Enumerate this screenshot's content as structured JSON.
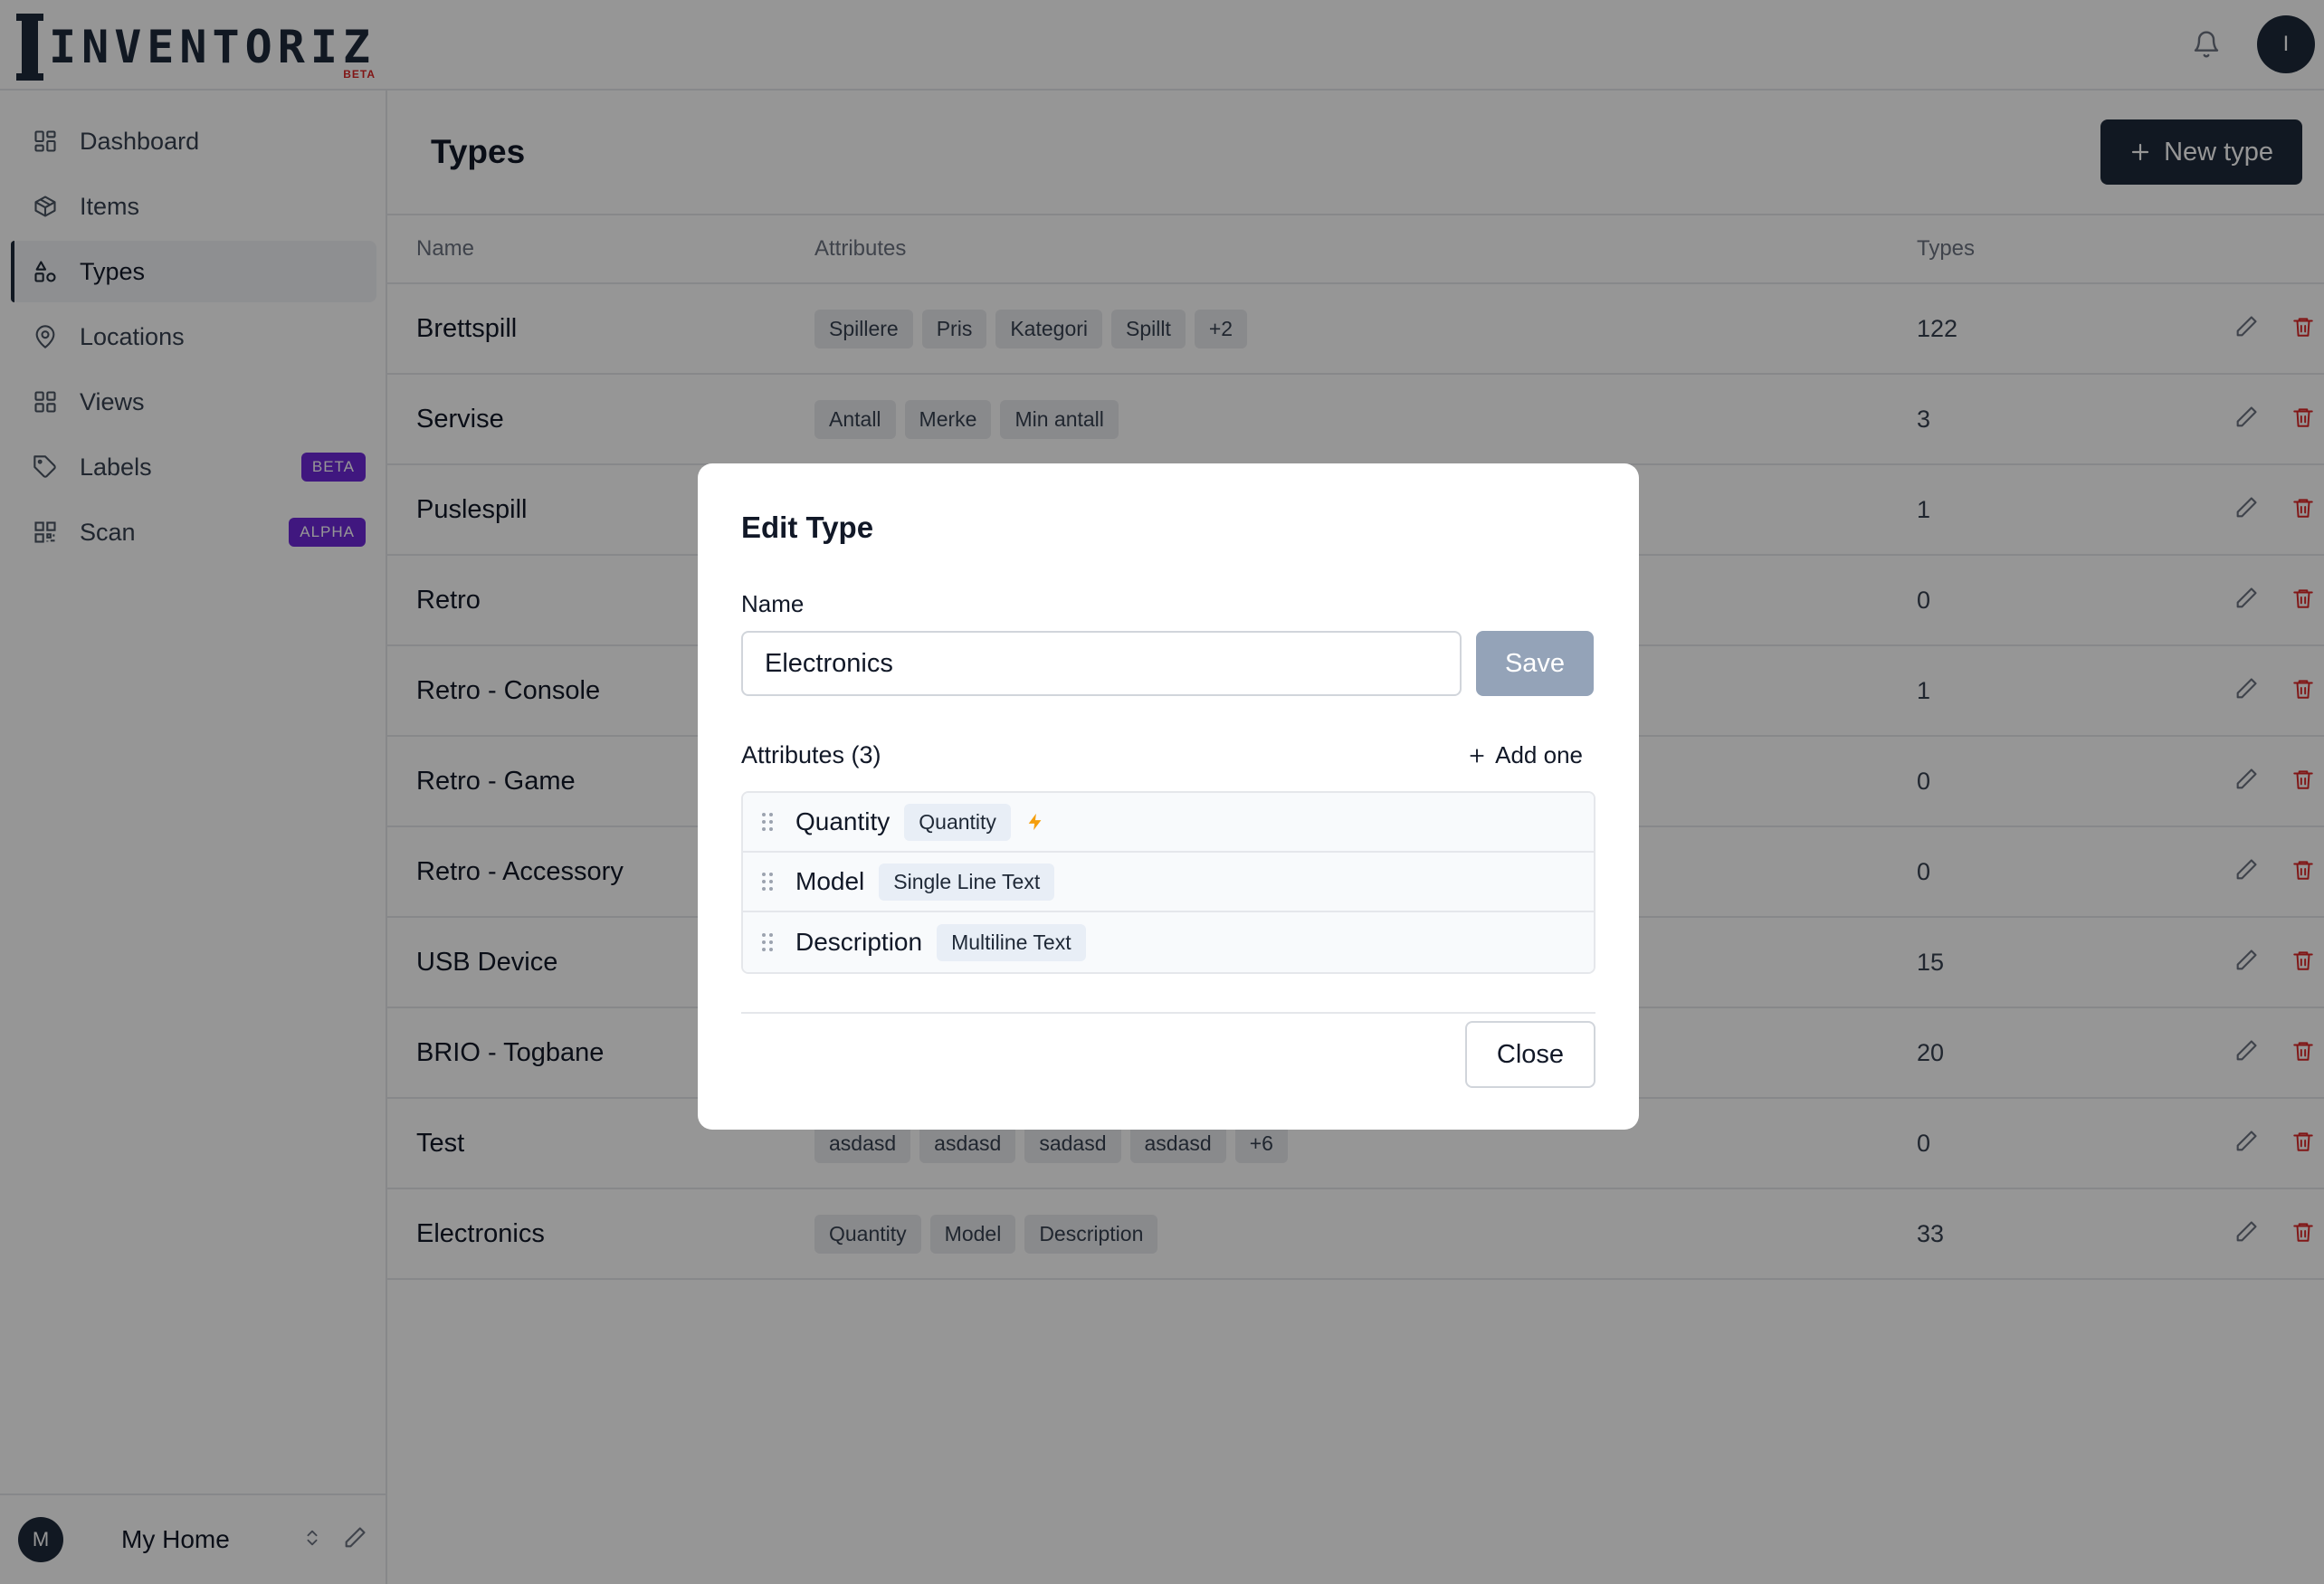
{
  "app": {
    "logo_text": "INVENTORIZ",
    "logo_badge": "BETA",
    "user_initial": "I"
  },
  "sidebar": {
    "items": [
      {
        "label": "Dashboard",
        "icon": "dashboard-icon"
      },
      {
        "label": "Items",
        "icon": "box-icon"
      },
      {
        "label": "Types",
        "icon": "shapes-icon",
        "active": true
      },
      {
        "label": "Locations",
        "icon": "map-pin-icon"
      },
      {
        "label": "Views",
        "icon": "grid-icon"
      },
      {
        "label": "Labels",
        "icon": "tag-icon",
        "badge": "BETA"
      },
      {
        "label": "Scan",
        "icon": "qr-icon",
        "badge": "ALPHA"
      }
    ],
    "footer": {
      "avatar": "M",
      "home_name": "My Home"
    }
  },
  "page": {
    "title": "Types",
    "new_button": "New type"
  },
  "table": {
    "headers": {
      "name": "Name",
      "attributes": "Attributes",
      "types": "Types"
    },
    "rows": [
      {
        "name": "Brettspill",
        "attrs": [
          "Spillere",
          "Pris",
          "Kategori",
          "Spillt",
          "+2"
        ],
        "count": "122"
      },
      {
        "name": "Servise",
        "attrs": [
          "Antall",
          "Merke",
          "Min antall"
        ],
        "count": "3"
      },
      {
        "name": "Puslespill",
        "attrs": [],
        "count": "1"
      },
      {
        "name": "Retro",
        "attrs": [],
        "count": "0"
      },
      {
        "name": "Retro - Console",
        "attrs": [],
        "count": "1"
      },
      {
        "name": "Retro - Game",
        "attrs": [],
        "count": "0"
      },
      {
        "name": "Retro - Accessory",
        "attrs": [],
        "count": "0"
      },
      {
        "name": "USB Device",
        "attrs": [],
        "count": "15"
      },
      {
        "name": "BRIO - Togbane",
        "attrs": [],
        "count": "20"
      },
      {
        "name": "Test",
        "attrs": [
          "asdasd",
          "asdasd",
          "sadasd",
          "asdasd",
          "+6"
        ],
        "count": "0"
      },
      {
        "name": "Electronics",
        "attrs": [
          "Quantity",
          "Model",
          "Description"
        ],
        "count": "33"
      }
    ]
  },
  "modal": {
    "title": "Edit Type",
    "name_label": "Name",
    "name_value": "Electronics",
    "save_label": "Save",
    "attributes_title": "Attributes (3)",
    "add_label": "Add one",
    "attributes": [
      {
        "name": "Quantity",
        "type": "Quantity",
        "has_bolt": true
      },
      {
        "name": "Model",
        "type": "Single Line Text",
        "has_bolt": false
      },
      {
        "name": "Description",
        "type": "Multiline Text",
        "has_bolt": false
      }
    ],
    "close_label": "Close"
  },
  "colors": {
    "brand": "#1e2a3b",
    "danger": "#dc2626",
    "badge": "#6d28d9",
    "bolt": "#f59e0b"
  }
}
